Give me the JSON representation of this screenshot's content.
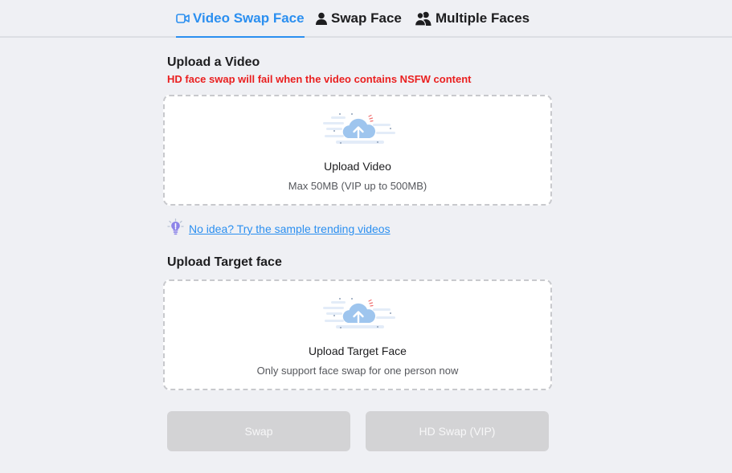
{
  "tabs": [
    {
      "label": "Video Swap Face",
      "icon": "video-camera-icon",
      "active": true
    },
    {
      "label": "Swap Face",
      "icon": "person-icon",
      "active": false
    },
    {
      "label": "Multiple Faces",
      "icon": "people-icon",
      "active": false
    }
  ],
  "video_section": {
    "title": "Upload a Video",
    "warning": "HD face swap will fail when the video contains NSFW content",
    "upload_label": "Upload Video",
    "upload_hint": "Max 50MB (VIP up to 500MB)"
  },
  "sample_link": {
    "text": "No idea? Try the sample trending videos",
    "icon": "lightbulb-icon"
  },
  "face_section": {
    "title": "Upload Target face",
    "upload_label": "Upload Target Face",
    "upload_hint": "Only support face swap for one person now"
  },
  "buttons": {
    "swap": "Swap",
    "hd_swap": "HD Swap (VIP)"
  },
  "colors": {
    "accent": "#2b8ff0",
    "warning": "#ea1f1f",
    "background": "#eff0f4",
    "disabled_button": "#d3d3d5"
  }
}
